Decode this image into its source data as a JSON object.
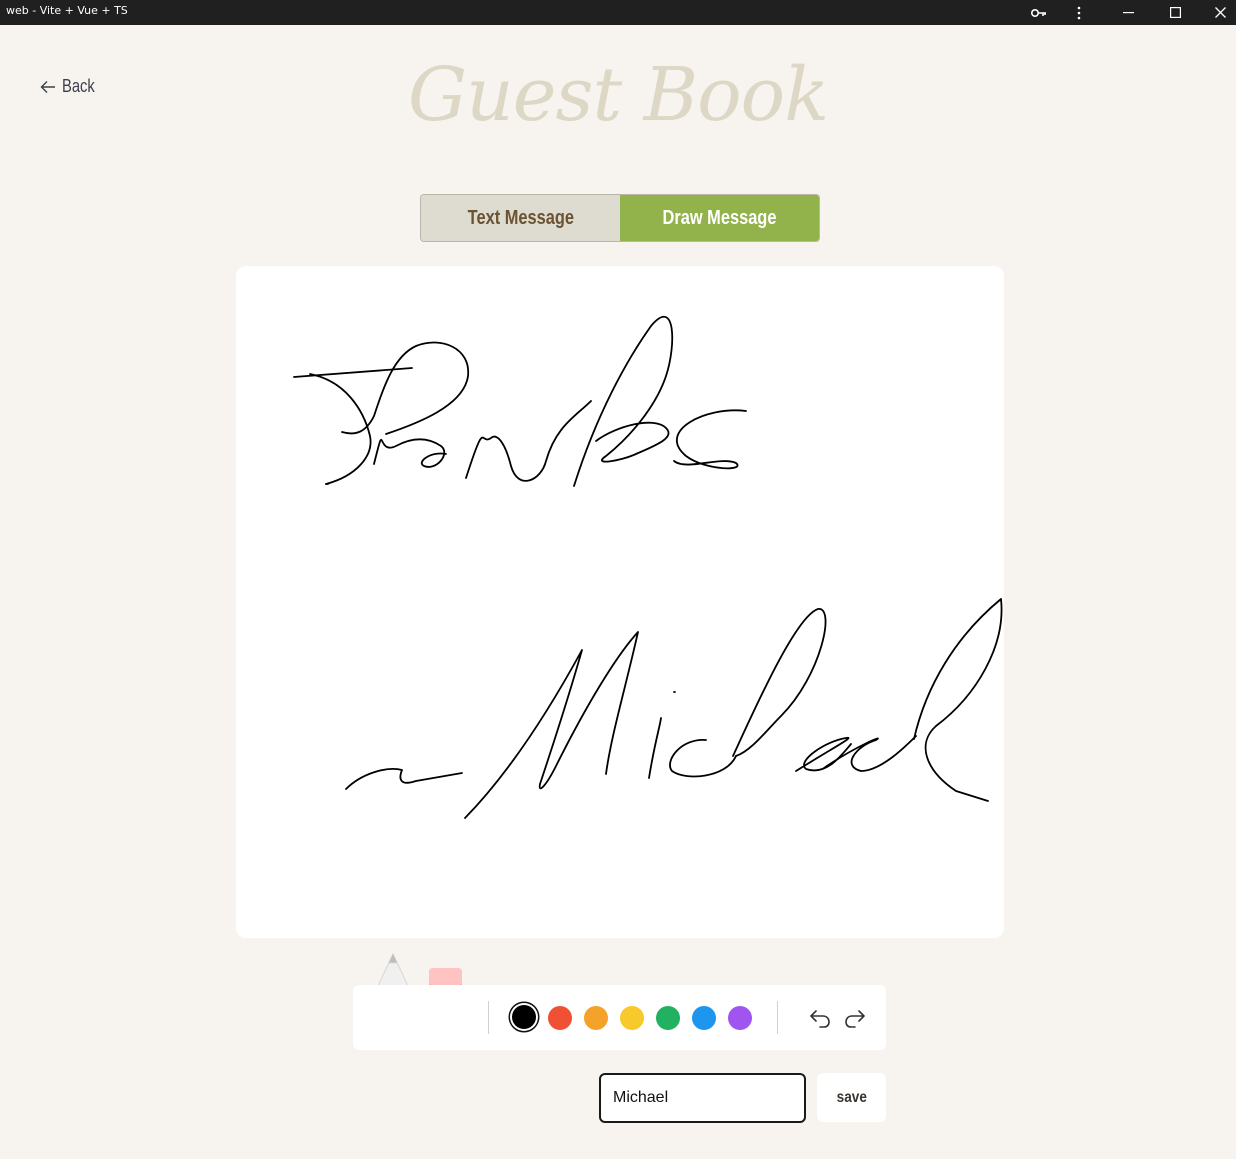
{
  "window": {
    "title": "web - Vite + Vue + TS"
  },
  "nav": {
    "back_label": "Back"
  },
  "page": {
    "heading": "Guest Book"
  },
  "tabs": [
    {
      "label": "Text Message",
      "active": false
    },
    {
      "label": "Draw Message",
      "active": true
    }
  ],
  "tools": {
    "pen_icon": "pencil-icon",
    "eraser_icon": "eraser-icon",
    "colors": [
      "#000000",
      "#f05033",
      "#f5a22a",
      "#f8c92a",
      "#22b160",
      "#1e95ef",
      "#a055ee"
    ],
    "selected_color": "#000000"
  },
  "name_field": {
    "value": "Michael"
  },
  "save": {
    "label": "save"
  },
  "colors": {
    "accent_green": "#92b34b",
    "tab_inactive": "#dedbd0",
    "background": "#f7f4ef"
  }
}
